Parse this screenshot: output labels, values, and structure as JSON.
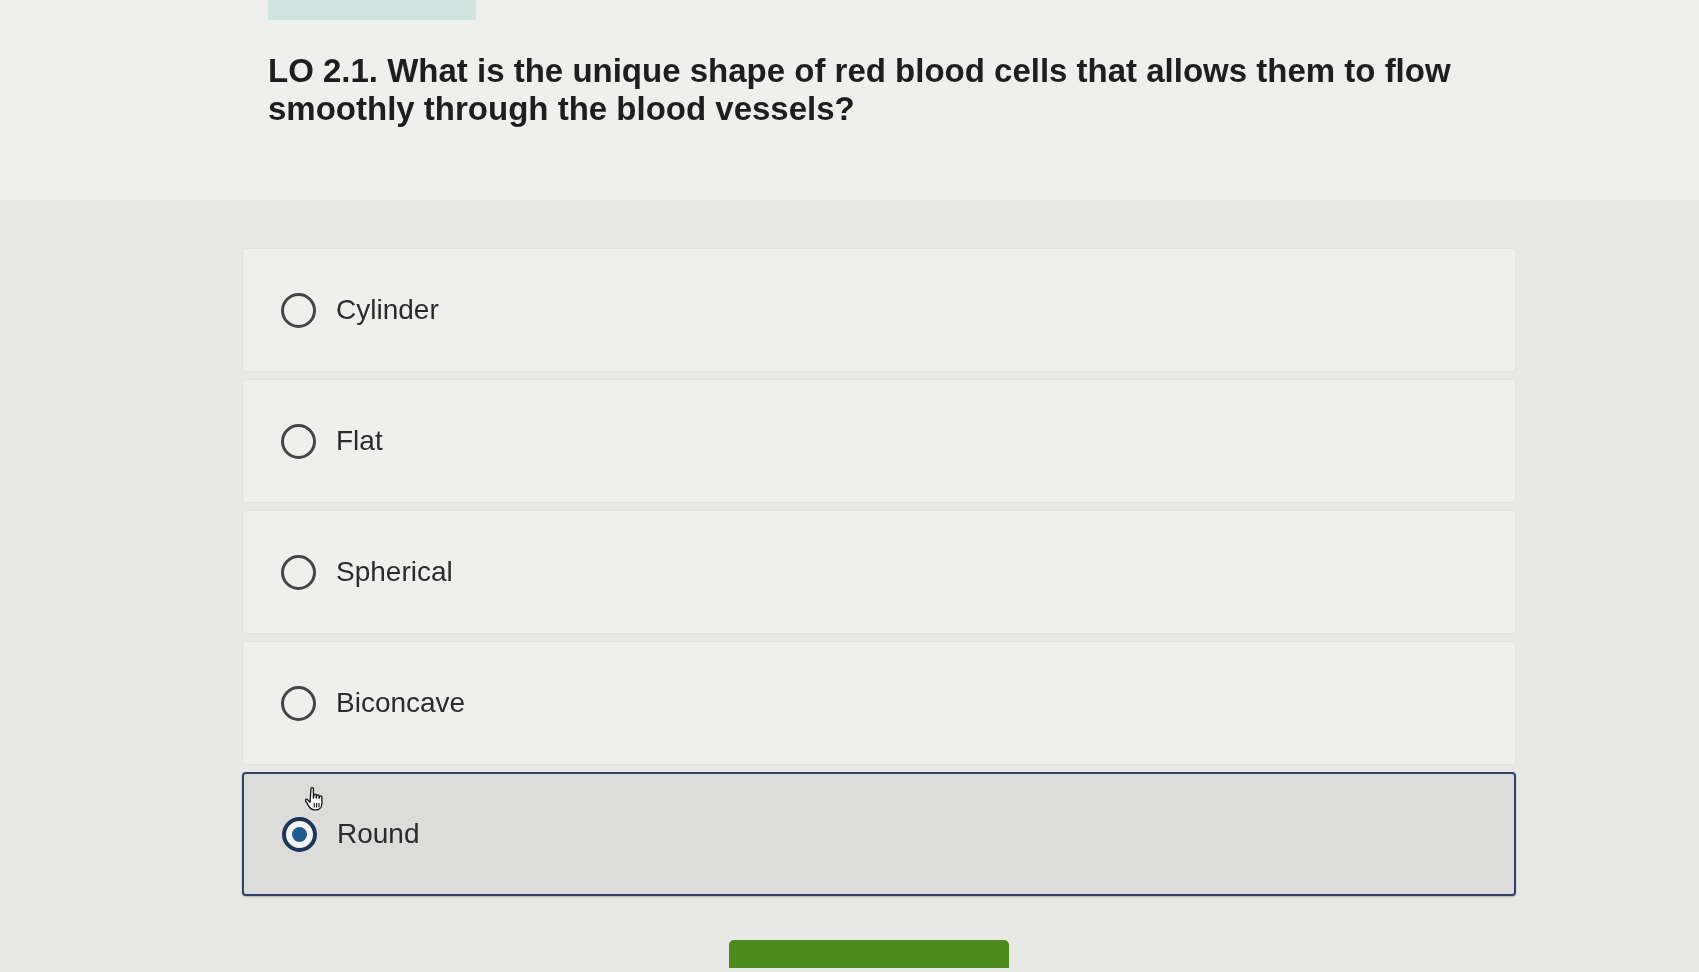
{
  "question": {
    "text": "LO 2.1. What is the unique shape of red blood cells that allows them to flow smoothly through the blood vessels?"
  },
  "options": [
    {
      "label": "Cylinder",
      "selected": false
    },
    {
      "label": "Flat",
      "selected": false
    },
    {
      "label": "Spherical",
      "selected": false
    },
    {
      "label": "Biconcave",
      "selected": false
    },
    {
      "label": "Round",
      "selected": true
    }
  ]
}
